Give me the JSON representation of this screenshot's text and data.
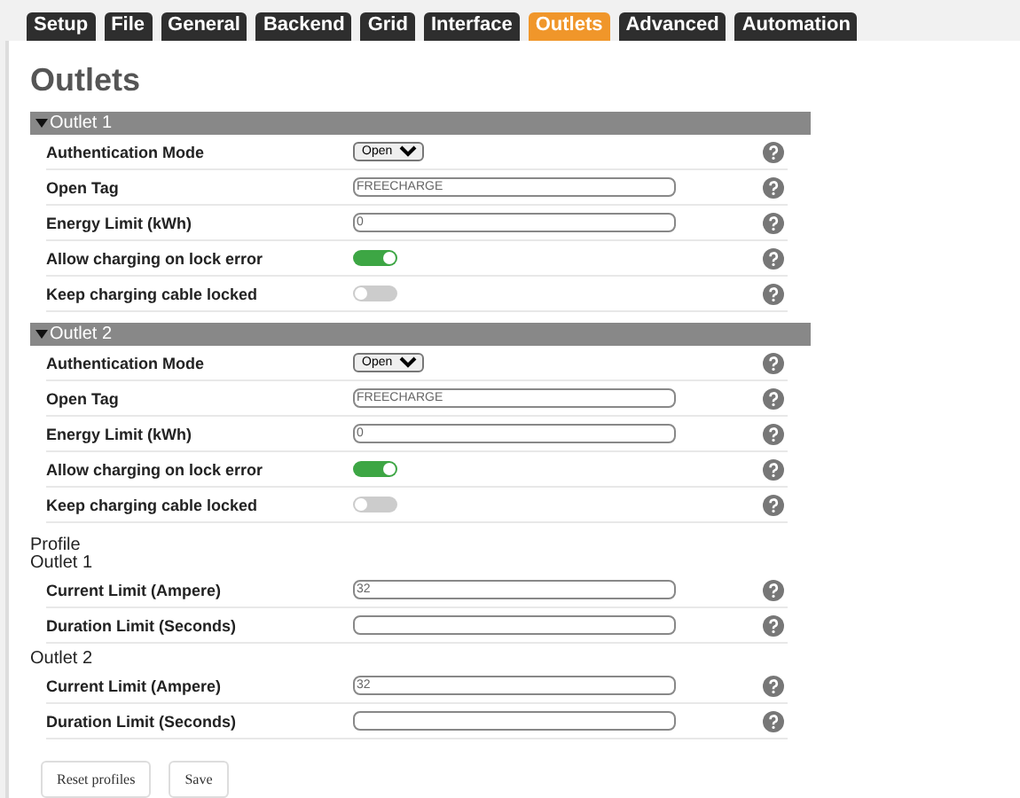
{
  "tabs": [
    {
      "label": "Setup",
      "selected": false
    },
    {
      "label": "File",
      "selected": false
    },
    {
      "label": "General",
      "selected": false
    },
    {
      "label": "Backend",
      "selected": false
    },
    {
      "label": "Grid",
      "selected": false
    },
    {
      "label": "Interface",
      "selected": false
    },
    {
      "label": "Outlets",
      "selected": true
    },
    {
      "label": "Advanced",
      "selected": false
    },
    {
      "label": "Automation",
      "selected": false
    }
  ],
  "title": "Outlets",
  "sections": [
    {
      "title": "Outlet 1",
      "expanded": true,
      "fields": [
        {
          "kind": "select",
          "label": "Authentication Mode",
          "value": "Open"
        },
        {
          "kind": "text",
          "label": "Open Tag",
          "value": "FREECHARGE"
        },
        {
          "kind": "text",
          "label": "Energy Limit (kWh)",
          "value": "0"
        },
        {
          "kind": "toggle",
          "label": "Allow charging on lock error",
          "on": true
        },
        {
          "kind": "toggle",
          "label": "Keep charging cable locked",
          "on": false
        }
      ]
    },
    {
      "title": "Outlet 2",
      "expanded": true,
      "fields": [
        {
          "kind": "select",
          "label": "Authentication Mode",
          "value": "Open"
        },
        {
          "kind": "text",
          "label": "Open Tag",
          "value": "FREECHARGE"
        },
        {
          "kind": "text",
          "label": "Energy Limit (kWh)",
          "value": "0"
        },
        {
          "kind": "toggle",
          "label": "Allow charging on lock error",
          "on": true
        },
        {
          "kind": "toggle",
          "label": "Keep charging cable locked",
          "on": false
        }
      ]
    }
  ],
  "profile": {
    "title": "Profile",
    "groups": [
      {
        "title": "Outlet 1",
        "fields": [
          {
            "kind": "text",
            "label": "Current Limit (Ampere)",
            "value": "32"
          },
          {
            "kind": "text",
            "label": "Duration Limit (Seconds)"
          }
        ]
      },
      {
        "title": "Outlet 2",
        "fields": [
          {
            "kind": "text",
            "label": "Current Limit (Ampere)",
            "value": "32"
          },
          {
            "kind": "text",
            "label": "Duration Limit (Seconds)"
          }
        ]
      }
    ]
  },
  "buttons": [
    "Reset profiles",
    "Save"
  ]
}
